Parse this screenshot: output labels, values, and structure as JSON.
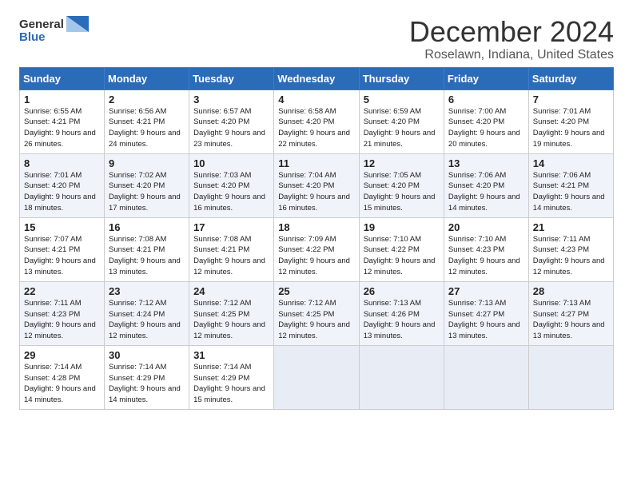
{
  "logo": {
    "line1": "General",
    "line2": "Blue"
  },
  "title": "December 2024",
  "subtitle": "Roselawn, Indiana, United States",
  "days_of_week": [
    "Sunday",
    "Monday",
    "Tuesday",
    "Wednesday",
    "Thursday",
    "Friday",
    "Saturday"
  ],
  "weeks": [
    [
      {
        "day": "1",
        "sunrise": "6:55 AM",
        "sunset": "4:21 PM",
        "daylight": "9 hours and 26 minutes."
      },
      {
        "day": "2",
        "sunrise": "6:56 AM",
        "sunset": "4:21 PM",
        "daylight": "9 hours and 24 minutes."
      },
      {
        "day": "3",
        "sunrise": "6:57 AM",
        "sunset": "4:20 PM",
        "daylight": "9 hours and 23 minutes."
      },
      {
        "day": "4",
        "sunrise": "6:58 AM",
        "sunset": "4:20 PM",
        "daylight": "9 hours and 22 minutes."
      },
      {
        "day": "5",
        "sunrise": "6:59 AM",
        "sunset": "4:20 PM",
        "daylight": "9 hours and 21 minutes."
      },
      {
        "day": "6",
        "sunrise": "7:00 AM",
        "sunset": "4:20 PM",
        "daylight": "9 hours and 20 minutes."
      },
      {
        "day": "7",
        "sunrise": "7:01 AM",
        "sunset": "4:20 PM",
        "daylight": "9 hours and 19 minutes."
      }
    ],
    [
      {
        "day": "8",
        "sunrise": "7:01 AM",
        "sunset": "4:20 PM",
        "daylight": "9 hours and 18 minutes."
      },
      {
        "day": "9",
        "sunrise": "7:02 AM",
        "sunset": "4:20 PM",
        "daylight": "9 hours and 17 minutes."
      },
      {
        "day": "10",
        "sunrise": "7:03 AM",
        "sunset": "4:20 PM",
        "daylight": "9 hours and 16 minutes."
      },
      {
        "day": "11",
        "sunrise": "7:04 AM",
        "sunset": "4:20 PM",
        "daylight": "9 hours and 16 minutes."
      },
      {
        "day": "12",
        "sunrise": "7:05 AM",
        "sunset": "4:20 PM",
        "daylight": "9 hours and 15 minutes."
      },
      {
        "day": "13",
        "sunrise": "7:06 AM",
        "sunset": "4:20 PM",
        "daylight": "9 hours and 14 minutes."
      },
      {
        "day": "14",
        "sunrise": "7:06 AM",
        "sunset": "4:21 PM",
        "daylight": "9 hours and 14 minutes."
      }
    ],
    [
      {
        "day": "15",
        "sunrise": "7:07 AM",
        "sunset": "4:21 PM",
        "daylight": "9 hours and 13 minutes."
      },
      {
        "day": "16",
        "sunrise": "7:08 AM",
        "sunset": "4:21 PM",
        "daylight": "9 hours and 13 minutes."
      },
      {
        "day": "17",
        "sunrise": "7:08 AM",
        "sunset": "4:21 PM",
        "daylight": "9 hours and 12 minutes."
      },
      {
        "day": "18",
        "sunrise": "7:09 AM",
        "sunset": "4:22 PM",
        "daylight": "9 hours and 12 minutes."
      },
      {
        "day": "19",
        "sunrise": "7:10 AM",
        "sunset": "4:22 PM",
        "daylight": "9 hours and 12 minutes."
      },
      {
        "day": "20",
        "sunrise": "7:10 AM",
        "sunset": "4:23 PM",
        "daylight": "9 hours and 12 minutes."
      },
      {
        "day": "21",
        "sunrise": "7:11 AM",
        "sunset": "4:23 PM",
        "daylight": "9 hours and 12 minutes."
      }
    ],
    [
      {
        "day": "22",
        "sunrise": "7:11 AM",
        "sunset": "4:23 PM",
        "daylight": "9 hours and 12 minutes."
      },
      {
        "day": "23",
        "sunrise": "7:12 AM",
        "sunset": "4:24 PM",
        "daylight": "9 hours and 12 minutes."
      },
      {
        "day": "24",
        "sunrise": "7:12 AM",
        "sunset": "4:25 PM",
        "daylight": "9 hours and 12 minutes."
      },
      {
        "day": "25",
        "sunrise": "7:12 AM",
        "sunset": "4:25 PM",
        "daylight": "9 hours and 12 minutes."
      },
      {
        "day": "26",
        "sunrise": "7:13 AM",
        "sunset": "4:26 PM",
        "daylight": "9 hours and 13 minutes."
      },
      {
        "day": "27",
        "sunrise": "7:13 AM",
        "sunset": "4:27 PM",
        "daylight": "9 hours and 13 minutes."
      },
      {
        "day": "28",
        "sunrise": "7:13 AM",
        "sunset": "4:27 PM",
        "daylight": "9 hours and 13 minutes."
      }
    ],
    [
      {
        "day": "29",
        "sunrise": "7:14 AM",
        "sunset": "4:28 PM",
        "daylight": "9 hours and 14 minutes."
      },
      {
        "day": "30",
        "sunrise": "7:14 AM",
        "sunset": "4:29 PM",
        "daylight": "9 hours and 14 minutes."
      },
      {
        "day": "31",
        "sunrise": "7:14 AM",
        "sunset": "4:29 PM",
        "daylight": "9 hours and 15 minutes."
      },
      null,
      null,
      null,
      null
    ]
  ],
  "labels": {
    "sunrise": "Sunrise:",
    "sunset": "Sunset:",
    "daylight": "Daylight:"
  }
}
